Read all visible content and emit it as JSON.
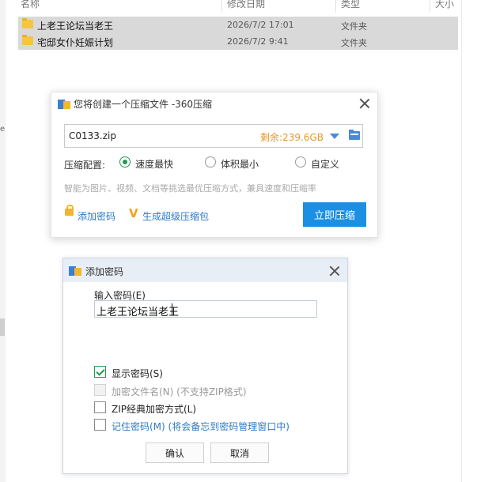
{
  "explorer": {
    "columns": {
      "name": "名称",
      "date": "修改日期",
      "type": "类型",
      "size": "大小"
    },
    "files": [
      {
        "name": "上老王论坛当老王",
        "date": "2026/7/2 17:01",
        "type": "文件夹"
      },
      {
        "name": "宅邸女仆妊娠计划",
        "date": "2026/7/2 9:41",
        "type": "文件夹"
      }
    ],
    "side_mark": "e"
  },
  "compress": {
    "title": "您将创建一个压缩文件 -360压缩",
    "file_name": "C0133.zip",
    "free_space": "剩余:239.6GB",
    "config_label": "压缩配置:",
    "options": [
      "速度最快",
      "体积最小",
      "自定义"
    ],
    "selected_option": "速度最快",
    "hint": "智能为图片、视频、文档等挑选最优压缩方式，兼具速度和压缩率",
    "add_password": "添加密码",
    "super_package": "生成超级压缩包",
    "compress_now": "立即压缩"
  },
  "password": {
    "title": "添加密码",
    "input_label": "输入密码(E)",
    "input_value": "上老王论坛当老王",
    "options": [
      {
        "label": "显示密码(S)",
        "checked": true,
        "disabled": false
      },
      {
        "label": "加密文件名(N) (不支持ZIP格式)",
        "checked": false,
        "disabled": true
      },
      {
        "label": "ZIP经典加密方式(L)",
        "checked": false,
        "disabled": false
      },
      {
        "label": "记住密码(M) (将会备忘到密码管理窗口中)",
        "checked": false,
        "disabled": false
      }
    ],
    "ok": "确认",
    "cancel": "取消"
  },
  "colors": {
    "accent": "#1a8fe3",
    "green": "#1f9a52",
    "link": "#2b79c8",
    "orange": "#e8962a"
  },
  "icons": [
    "folder-icon",
    "app-icon",
    "close-icon",
    "dropdown-icon",
    "browse-folder-icon",
    "lock-icon",
    "v-icon",
    "checkbox-check-icon"
  ]
}
